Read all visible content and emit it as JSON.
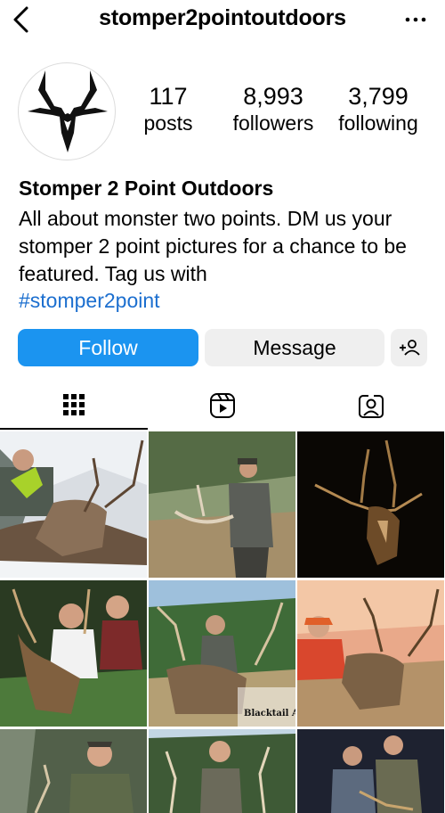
{
  "header": {
    "username": "stomper2pointoutdoors",
    "back_icon": "chevron-left-icon",
    "more_icon": "ellipsis-icon"
  },
  "profile": {
    "stats": [
      {
        "value": "117",
        "label": "posts"
      },
      {
        "value": "8,993",
        "label": "followers"
      },
      {
        "value": "3,799",
        "label": "following"
      }
    ],
    "display_name": "Stomper 2 Point Outdoors",
    "bio": "All about monster two points. DM us your stomper 2 point pictures for a chance to be featured. Tag us with",
    "hashtag": "#stomper2point"
  },
  "actions": {
    "follow_label": "Follow",
    "message_label": "Message",
    "suggest_icon": "add-person-icon"
  },
  "tabs": [
    {
      "name": "grid",
      "icon": "grid-icon",
      "active": true
    },
    {
      "name": "reels",
      "icon": "reels-icon",
      "active": false
    },
    {
      "name": "tagged",
      "icon": "tagged-person-icon",
      "active": false
    }
  ],
  "posts": [
    {
      "caption": ""
    },
    {
      "caption": ""
    },
    {
      "caption": ""
    },
    {
      "caption": ""
    },
    {
      "caption": "Blacktail Add"
    },
    {
      "caption": ""
    },
    {
      "caption": ""
    },
    {
      "caption": ""
    },
    {
      "caption": ""
    }
  ],
  "colors": {
    "follow_button": "#1b94f0",
    "secondary_button": "#efefef",
    "hashtag": "#1c6fcf"
  }
}
